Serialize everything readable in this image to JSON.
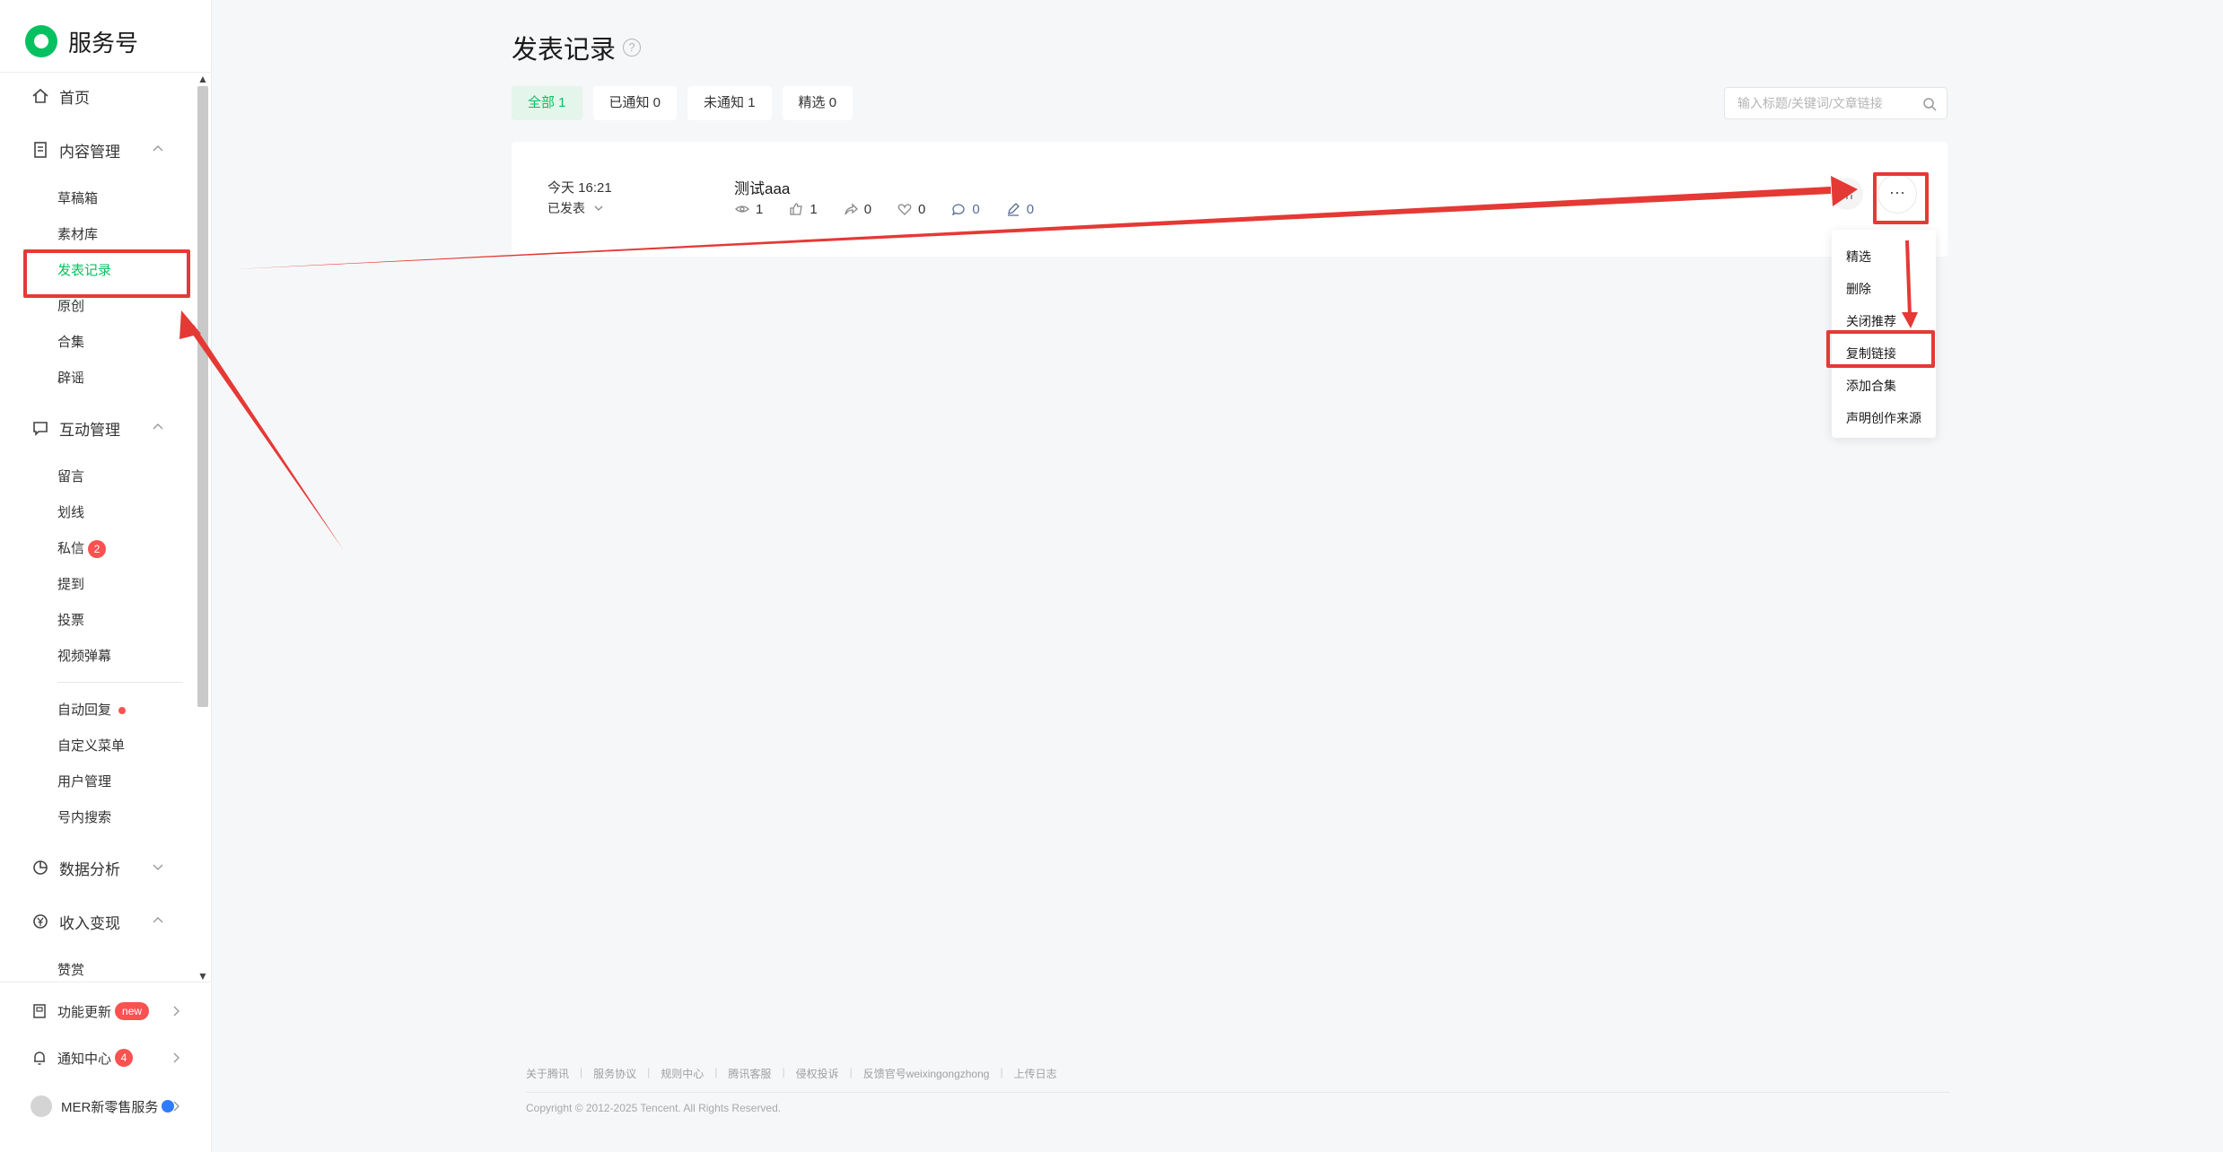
{
  "brand": {
    "name": "服务号"
  },
  "sidebar": {
    "home": "首页",
    "content_group": "内容管理",
    "content_items": [
      "草稿箱",
      "素材库",
      "发表记录",
      "原创",
      "合集",
      "辟谣"
    ],
    "interaction_group": "互动管理",
    "interaction_items": [
      "留言",
      "划线",
      "私信",
      "提到",
      "投票",
      "视频弹幕"
    ],
    "private_badge": "2",
    "tools_items": [
      "自动回复",
      "自定义菜单",
      "用户管理",
      "号内搜索"
    ],
    "data_group": "数据分析",
    "income_group": "收入变现",
    "income_items": [
      "赞赏"
    ],
    "bottom": {
      "updates": "功能更新",
      "updates_badge": "new",
      "notices": "通知中心",
      "notices_badge": "4",
      "account": "MER新零售服务"
    }
  },
  "main": {
    "title": "发表记录",
    "help": "?",
    "tabs": [
      {
        "label": "全部 1",
        "active": true
      },
      {
        "label": "已通知 0",
        "active": false
      },
      {
        "label": "未通知 1",
        "active": false
      },
      {
        "label": "精选 0",
        "active": false
      }
    ],
    "search_placeholder": "输入标题/关键词/文章链接"
  },
  "article": {
    "time": "今天 16:21",
    "status": "已发表",
    "title": "测试aaa",
    "stats": {
      "views": "1",
      "likes": "1",
      "shares": "0",
      "favorites": "0",
      "comments": "0",
      "underlines": "0"
    },
    "more": "···"
  },
  "dropdown": [
    "精选",
    "删除",
    "关闭推荐",
    "复制链接",
    "添加合集",
    "声明创作来源"
  ],
  "footer": {
    "links": [
      "关于腾讯",
      "服务协议",
      "规则中心",
      "腾讯客服",
      "侵权投诉",
      "反馈官号weixingongzhong",
      "上传日志"
    ],
    "copyright": "Copyright © 2012-2025 Tencent. All Rights Reserved."
  },
  "colors": {
    "accent": "#07c160",
    "badge": "#fa5151",
    "annotation": "#e53935",
    "link_blue": "#576b95"
  }
}
